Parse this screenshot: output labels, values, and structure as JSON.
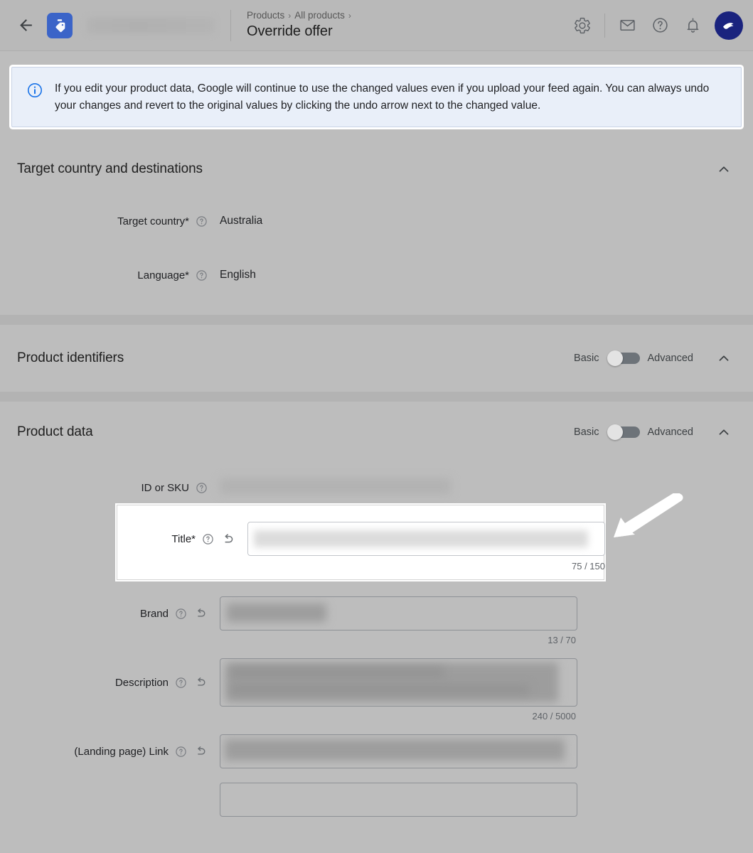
{
  "header": {
    "back_icon": "back-arrow-icon",
    "app_logo_icon": "merchant-center-tag-logo",
    "breadcrumb": [
      "Products",
      "All products"
    ],
    "breadcrumb_separator": "›",
    "title": "Override offer",
    "icons": [
      {
        "name": "gear-icon",
        "label": "Settings"
      },
      {
        "name": "mail-icon",
        "label": "Messages"
      },
      {
        "name": "help-icon",
        "label": "Help"
      },
      {
        "name": "bell-icon",
        "label": "Notifications"
      }
    ],
    "avatar_icon": "account-avatar",
    "account_name_redacted": ""
  },
  "banner": {
    "icon": "info-circle-icon",
    "text": "If you edit your product data, Google will continue to use the changed values even if you upload your feed again. You can always undo your changes and revert to the original values by clicking the undo arrow next to the changed value."
  },
  "sections": [
    {
      "id": "target-country-and-destinations",
      "title": "Target country and destinations",
      "collapse_icon": "chevron-up-icon",
      "fields": [
        {
          "label": "Target country*",
          "help_icon": "help-circle-icon",
          "value": "Australia"
        },
        {
          "label": "Language*",
          "help_icon": "help-circle-icon",
          "value": "English"
        }
      ]
    },
    {
      "id": "product-identifiers",
      "title": "Product identifiers",
      "collapse_icon": "chevron-up-icon",
      "toggle": {
        "left_label": "Basic",
        "right_label": "Advanced",
        "state": "Basic"
      }
    },
    {
      "id": "product-data",
      "title": "Product data",
      "collapse_icon": "chevron-up-icon",
      "toggle": {
        "left_label": "Basic",
        "right_label": "Advanced",
        "state": "Basic"
      },
      "fields": [
        {
          "label": "ID or SKU",
          "help_icon": "help-circle-icon",
          "value_redacted": true
        },
        {
          "label": "Title*",
          "help_icon": "help-circle-icon",
          "undo_icon": "undo-arrow-icon",
          "counter": "75 / 150",
          "value_redacted": true,
          "highlighted": true
        },
        {
          "label": "Brand",
          "help_icon": "help-circle-icon",
          "undo_icon": "undo-arrow-icon",
          "counter": "13 / 70",
          "value_redacted": true
        },
        {
          "label": "Description",
          "help_icon": "help-circle-icon",
          "undo_icon": "undo-arrow-icon",
          "counter": "240 / 5000",
          "value_redacted": true
        },
        {
          "label": "(Landing page) Link",
          "help_icon": "help-circle-icon",
          "undo_icon": "undo-arrow-icon",
          "value_redacted": true
        }
      ]
    }
  ],
  "annotation": {
    "arrow_icon": "white-pointer-arrow",
    "points_to": "Title*"
  },
  "colors": {
    "page_background": "#bdbdbd",
    "banner_background": "#e9eff9",
    "banner_border": "#c9d3e6",
    "accent_blue": "#1a73e8",
    "logo_blue": "#3b64c8",
    "avatar_blue": "#1a237e",
    "text_primary": "#202124",
    "text_secondary": "#5f6368",
    "input_border": "#8e9196",
    "toggle_track": "#6d7379",
    "toggle_knob": "#e3e3e3",
    "highlight_white": "#ffffff"
  }
}
